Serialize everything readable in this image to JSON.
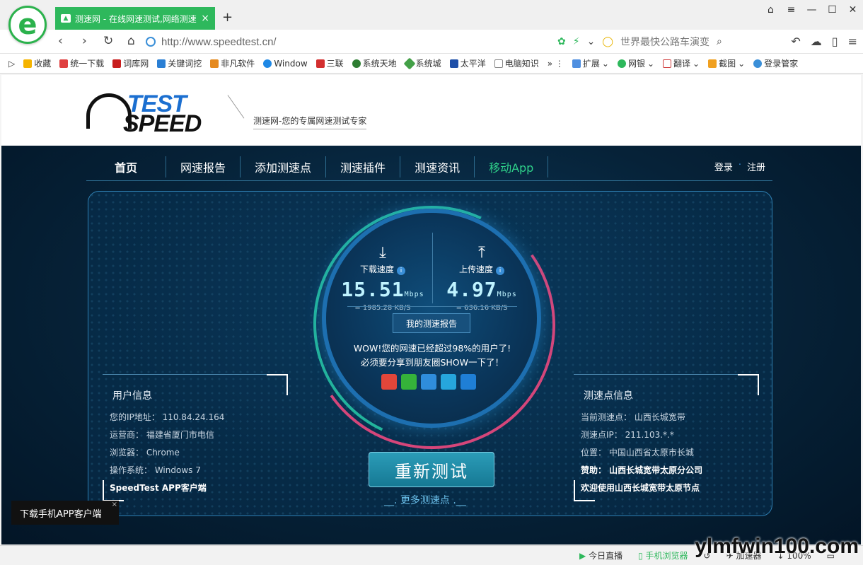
{
  "browser": {
    "tab_title": "测速网 - 在线网速测试,网络测速",
    "url": "http://www.speedtest.cn/",
    "search_hint": "世界最快公路车演变",
    "bookmarks": [
      "收藏",
      "统一下载",
      "词库网",
      "关键词挖",
      "非凡软件",
      "Window",
      "三联",
      "系统天地",
      "系统城",
      "太平洋",
      "电脑知识",
      "扩展",
      "网银",
      "翻译",
      "截图",
      "登录管家"
    ]
  },
  "header": {
    "brand_top": "TEST",
    "brand_bottom": "SPEED",
    "slogan": "测速网-您的专属网速测试专家"
  },
  "menu": {
    "items": [
      "首页",
      "网速报告",
      "添加测速点",
      "测速插件",
      "测速资讯",
      "移动App"
    ],
    "login": "登录",
    "register": "注册"
  },
  "speed": {
    "download_label": "下载速度",
    "download_value": "15.51",
    "download_unit": "Mbps",
    "download_kbs": "= 1985.28 KB/S",
    "upload_label": "上传速度",
    "upload_value": "4.97",
    "upload_unit": "Mbps",
    "upload_kbs": "= 636.16 KB/S",
    "report_button": "我的测速报告",
    "wow_line1": "WOW!您的网速已经超过98%的用户了!",
    "wow_line2": "必须要分享到朋友圈SHOW一下了！"
  },
  "user_info": {
    "title": "用户信息",
    "ip": "您的IP地址： 110.84.24.164",
    "isp": "运营商： 福建省厦门市电信",
    "browser": "浏览器： Chrome",
    "os": "操作系统： Windows 7",
    "app": "SpeedTest APP客户端"
  },
  "node_info": {
    "title": "测速点信息",
    "node": "当前测速点： 山西长城宽带",
    "node_ip": "测速点IP： 211.103.*.*",
    "location": "位置： 中国山西省太原市长城",
    "sponsor": "赞助： 山西长城宽带太原分公司",
    "welcome": "欢迎使用山西长城宽带太原节点"
  },
  "actions": {
    "retest": "重新测试",
    "more": "更多测速点",
    "download_app": "下载手机APP客户端"
  },
  "statusbar": {
    "live": "今日直播",
    "mobile": "手机浏览器",
    "accelerator": "加速器",
    "zoom": "100%"
  },
  "watermark": "ylmfwin100.com",
  "colors": {
    "tab_green": "#2eb85c",
    "hero_bg": "#062238",
    "accent_teal": "#2fd18a"
  }
}
